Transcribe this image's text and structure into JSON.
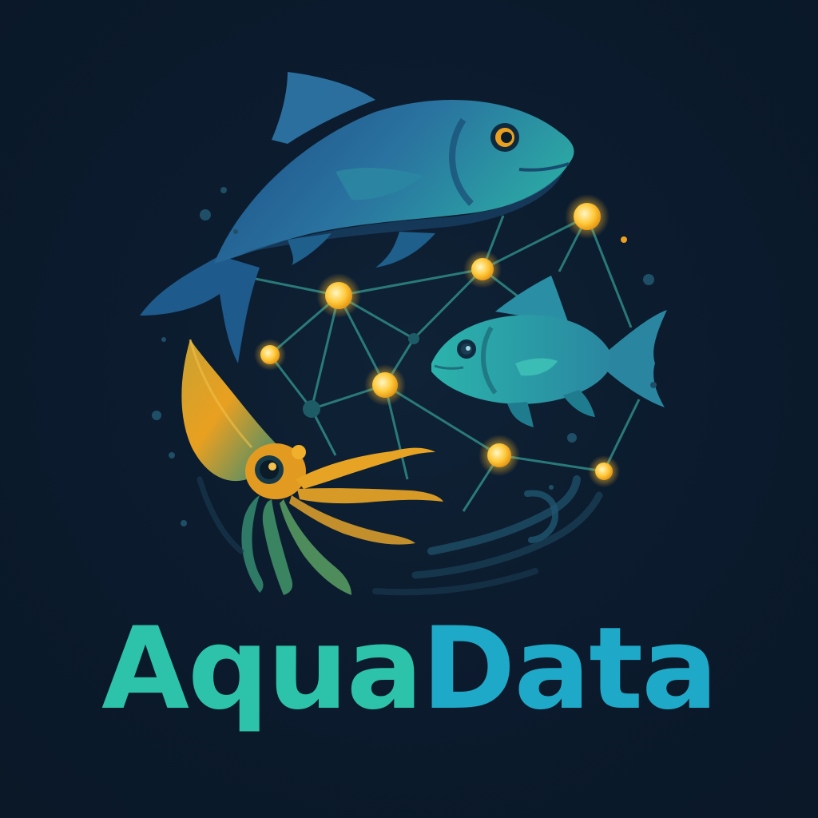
{
  "brand": {
    "name_part_1": "Aqua",
    "name_part_2": "Data"
  },
  "icons": [
    "tuna-icon",
    "small-fish-icon",
    "squid-icon",
    "data-network-icon",
    "wave-icon"
  ],
  "colors": {
    "background": "#0b1a2c",
    "wordmark_aqua": "#2cc3aa",
    "wordmark_data": "#1fa9c8",
    "fish_blue": "#2a6f96",
    "fish_teal": "#2fa7a6",
    "squid_orange": "#e9a020",
    "node_glow": "#ffc83a",
    "network_line": "#2f8a86"
  }
}
